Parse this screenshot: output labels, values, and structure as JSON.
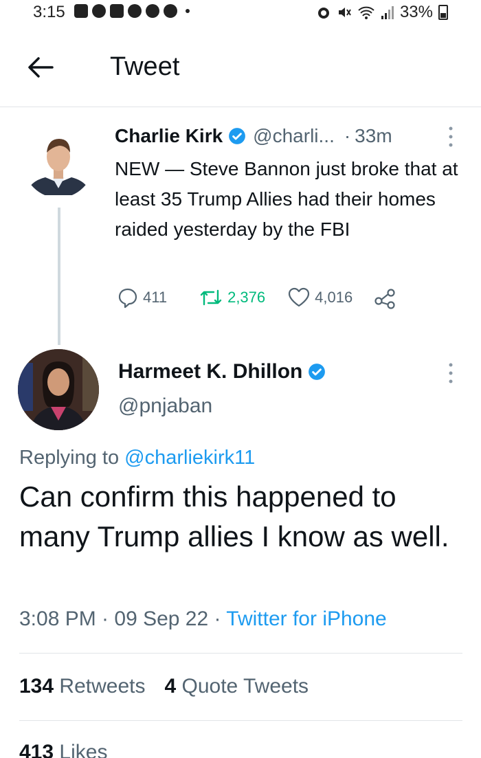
{
  "status_bar": {
    "time": "3:15",
    "battery": "33%"
  },
  "header": {
    "title": "Tweet"
  },
  "parent_tweet": {
    "name": "Charlie Kirk",
    "handle": "@charli...",
    "separator": "·",
    "time": "33m",
    "text": "NEW — Steve Bannon just broke that at least 35 Trump Allies had their homes raided yesterday by the FBI",
    "replies": "411",
    "retweets": "2,376",
    "likes": "4,016"
  },
  "reply_tweet": {
    "name": "Harmeet K. Dhillon",
    "handle": "@pnjaban",
    "replying_prefix": "Replying to",
    "replying_to": "@charliekirk11",
    "text": "Can confirm this happened to many Trump allies I know as well.",
    "timestamp": "3:08 PM · 09 Sep 22 ·",
    "source": "Twitter for iPhone",
    "retweets_count": "134",
    "retweets_label": "Retweets",
    "quotes_count": "4",
    "quotes_label": "Quote Tweets",
    "likes_count": "413",
    "likes_label": "Likes"
  },
  "colors": {
    "accent": "#1d9bf0",
    "retweet": "#00ba7c",
    "secondary_text": "#536471"
  }
}
